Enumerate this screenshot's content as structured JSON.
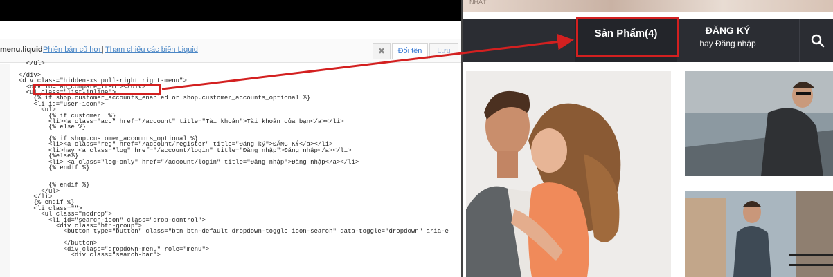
{
  "editor": {
    "filename": "menu.liquid",
    "links": {
      "old_version": "Phiên bản cũ hơn",
      "separator": "|",
      "liquid_ref": "Tham chiếu các biến Liquid"
    },
    "buttons": {
      "close": "✖",
      "rename": "Đổi tên",
      "save": "Lưu"
    },
    "code_lines": [
      "    </ul>",
      "",
      "  </div>",
      "  <div class=\"hidden-xs pull-right right-menu\">",
      "    <div id=\"ap_compare_item\"></div>",
      "    <ul class=\"list-inline\">",
      "      {% if shop.customer_accounts_enabled or shop.customer_accounts_optional %}",
      "      <li id=\"user-icon\">",
      "        <ul>",
      "          {% if customer  %}",
      "          <li><a class=\"acc\" href=\"/account\" title=\"Tài khoản\">Tài khoản của bạn</a></li>",
      "          {% else %}",
      "",
      "          {% if shop.customer_accounts_optional %}",
      "          <li><a class=\"reg\" href=\"/account/register\" title=\"Đăng ký\">ĐĂNG KÝ</a></li>",
      "          <li>hay <a class=\"log\" href=\"/account/login\" title=\"Đăng nhập\">Đăng nhập</a></li>",
      "          {%else%}",
      "          <li> <a class=\"log-only\" href=\"/account/login\" title=\"Đăng nhập\">Đăng nhập</a></li>",
      "          {% endif %}",
      "",
      "",
      "          {% endif %}",
      "        </ul>",
      "      </li>",
      "      {% endif %}",
      "      <li class=\"\">",
      "        <ul class=\"nodrop\">",
      "          <li id=\"search-icon\" class=\"drop-control\">",
      "            <div class=\"btn-group\">",
      "              <button type=\"button\" class=\"btn btn-default dropdown-toggle icon-search\" data-toggle=\"dropdown\" aria-e",
      "",
      "              </button>",
      "              <div class=\"dropdown-menu\" role=\"menu\">",
      "                <div class=\"search-bar\">"
    ]
  },
  "site": {
    "banner_text": "NHẤT",
    "nav": {
      "product": "Sản Phẩm(4)",
      "register": "ĐĂNG KÝ",
      "login_prefix": "hay",
      "login": "Đăng nhập"
    },
    "icons": {
      "search": "search-icon"
    }
  },
  "colors": {
    "annotation_red": "#d32020",
    "nav_bg": "#2b2d33"
  }
}
